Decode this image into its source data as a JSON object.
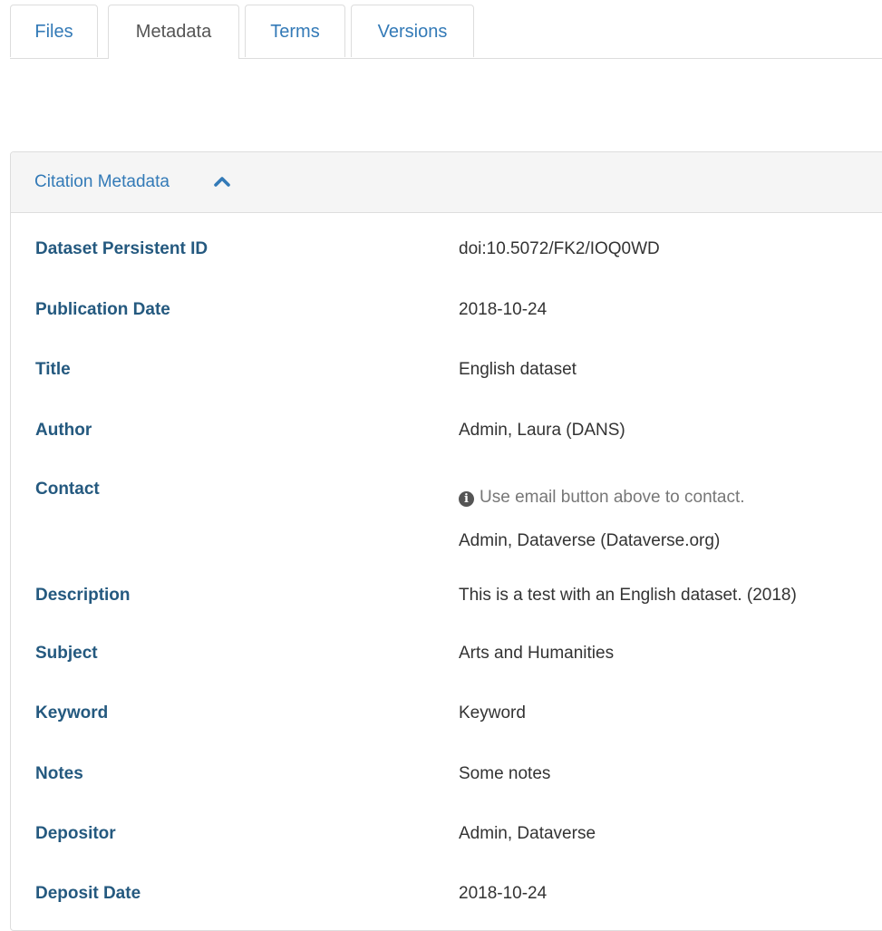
{
  "tabs": [
    {
      "label": "Files"
    },
    {
      "label": "Metadata"
    },
    {
      "label": "Terms"
    },
    {
      "label": "Versions"
    }
  ],
  "active_tab": "Metadata",
  "panel": {
    "title": "Citation Metadata",
    "toggle_icon": "chevron-up-icon"
  },
  "fields": [
    {
      "label": "Dataset Persistent ID",
      "value": "doi:10.5072/FK2/IOQ0WD"
    },
    {
      "label": "Publication Date",
      "value": "2018-10-24"
    },
    {
      "label": "Title",
      "value": "English dataset"
    },
    {
      "label": "Author",
      "value": "Admin, Laura (DANS)"
    },
    {
      "label": "Contact",
      "note": "Use email button above to contact.",
      "note_icon": "info-circle-icon",
      "value": "Admin, Dataverse (Dataverse.org)"
    },
    {
      "label": "Description",
      "value": "This is a test with an English dataset. (2018)"
    },
    {
      "label": "Subject",
      "value": "Arts and Humanities"
    },
    {
      "label": "Keyword",
      "value": "Keyword"
    },
    {
      "label": "Notes",
      "value": "Some notes"
    },
    {
      "label": "Depositor",
      "value": "Admin, Dataverse"
    },
    {
      "label": "Deposit Date",
      "value": "2018-10-24"
    }
  ],
  "colors": {
    "link": "#337ab7",
    "label": "#24597f",
    "text": "#333333",
    "muted": "#777777",
    "border": "#dddddd",
    "heading_bg": "#f5f5f5"
  }
}
